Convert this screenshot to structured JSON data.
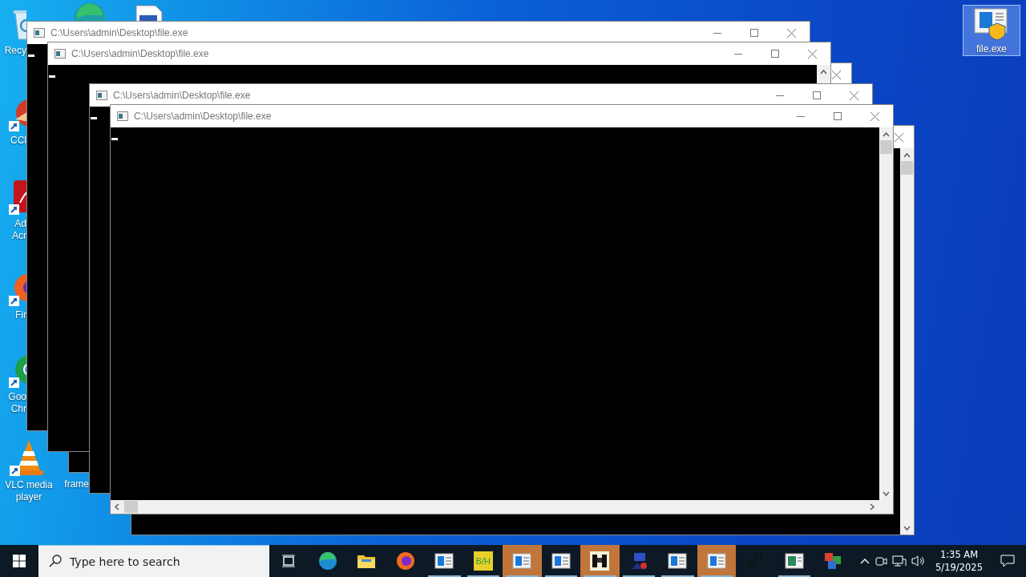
{
  "desktop_icons": [
    {
      "label": "Recy",
      "kind": "recycle",
      "selected": false
    },
    {
      "kind": "edge",
      "selected": false
    },
    {
      "kind": "document",
      "selected": false
    },
    {
      "label": "CCl",
      "kind": "ccleaner",
      "selected": false
    },
    {
      "label": "Ad\nAcr",
      "kind": "acrobat",
      "selected": false
    },
    {
      "label": "Fir",
      "kind": "firefox",
      "selected": false
    },
    {
      "label": "Goo\nChr",
      "kind": "chrome",
      "selected": false
    },
    {
      "label": "VLC media\nplayer",
      "kind": "vlc",
      "selected": false
    },
    {
      "label": "frame",
      "kind": "none",
      "selected": false
    },
    {
      "label": "file.exe",
      "kind": "installer",
      "selected": true
    }
  ],
  "windows": [
    {
      "title": "C:\\Users\\admin\\Desktop\\file.exe",
      "kind": "console"
    },
    {
      "title": "C:\\Users\\admin\\Desktop\\file.exe",
      "kind": "console"
    },
    {
      "kind": "console"
    },
    {
      "title": "C:\\Users\\admin\\Desktop\\file.exe",
      "kind": "console"
    },
    {
      "title": "C:\\Users\\admin\\Desktop\\file.exe",
      "kind": "console"
    },
    {
      "kind": "console"
    }
  ],
  "taskbar": {
    "search": {
      "placeholder": "Type here to search"
    },
    "apps": [
      {
        "kind": "taskview",
        "running": false,
        "flashing": false
      },
      {
        "kind": "edge",
        "running": false,
        "flashing": false
      },
      {
        "kind": "explorer",
        "running": false,
        "flashing": false
      },
      {
        "kind": "firefox",
        "running": false,
        "flashing": false
      },
      {
        "kind": "window",
        "running": true,
        "flashing": false
      },
      {
        "kind": "tile",
        "label": "B/H",
        "running": true,
        "flashing": false
      },
      {
        "kind": "window",
        "running": true,
        "flashing": true
      },
      {
        "kind": "window",
        "running": true,
        "flashing": false
      },
      {
        "kind": "binoculars",
        "running": true,
        "flashing": true
      },
      {
        "kind": "tool",
        "running": true,
        "flashing": false
      },
      {
        "kind": "window",
        "running": true,
        "flashing": false
      },
      {
        "kind": "window",
        "running": true,
        "flashing": true
      },
      {
        "kind": "link",
        "running": false,
        "flashing": false
      },
      {
        "kind": "panel",
        "running": true,
        "flashing": false
      },
      {
        "kind": "boxes",
        "running": false,
        "flashing": false
      }
    ],
    "time": "1:35 AM",
    "date": "5/19/2025"
  }
}
